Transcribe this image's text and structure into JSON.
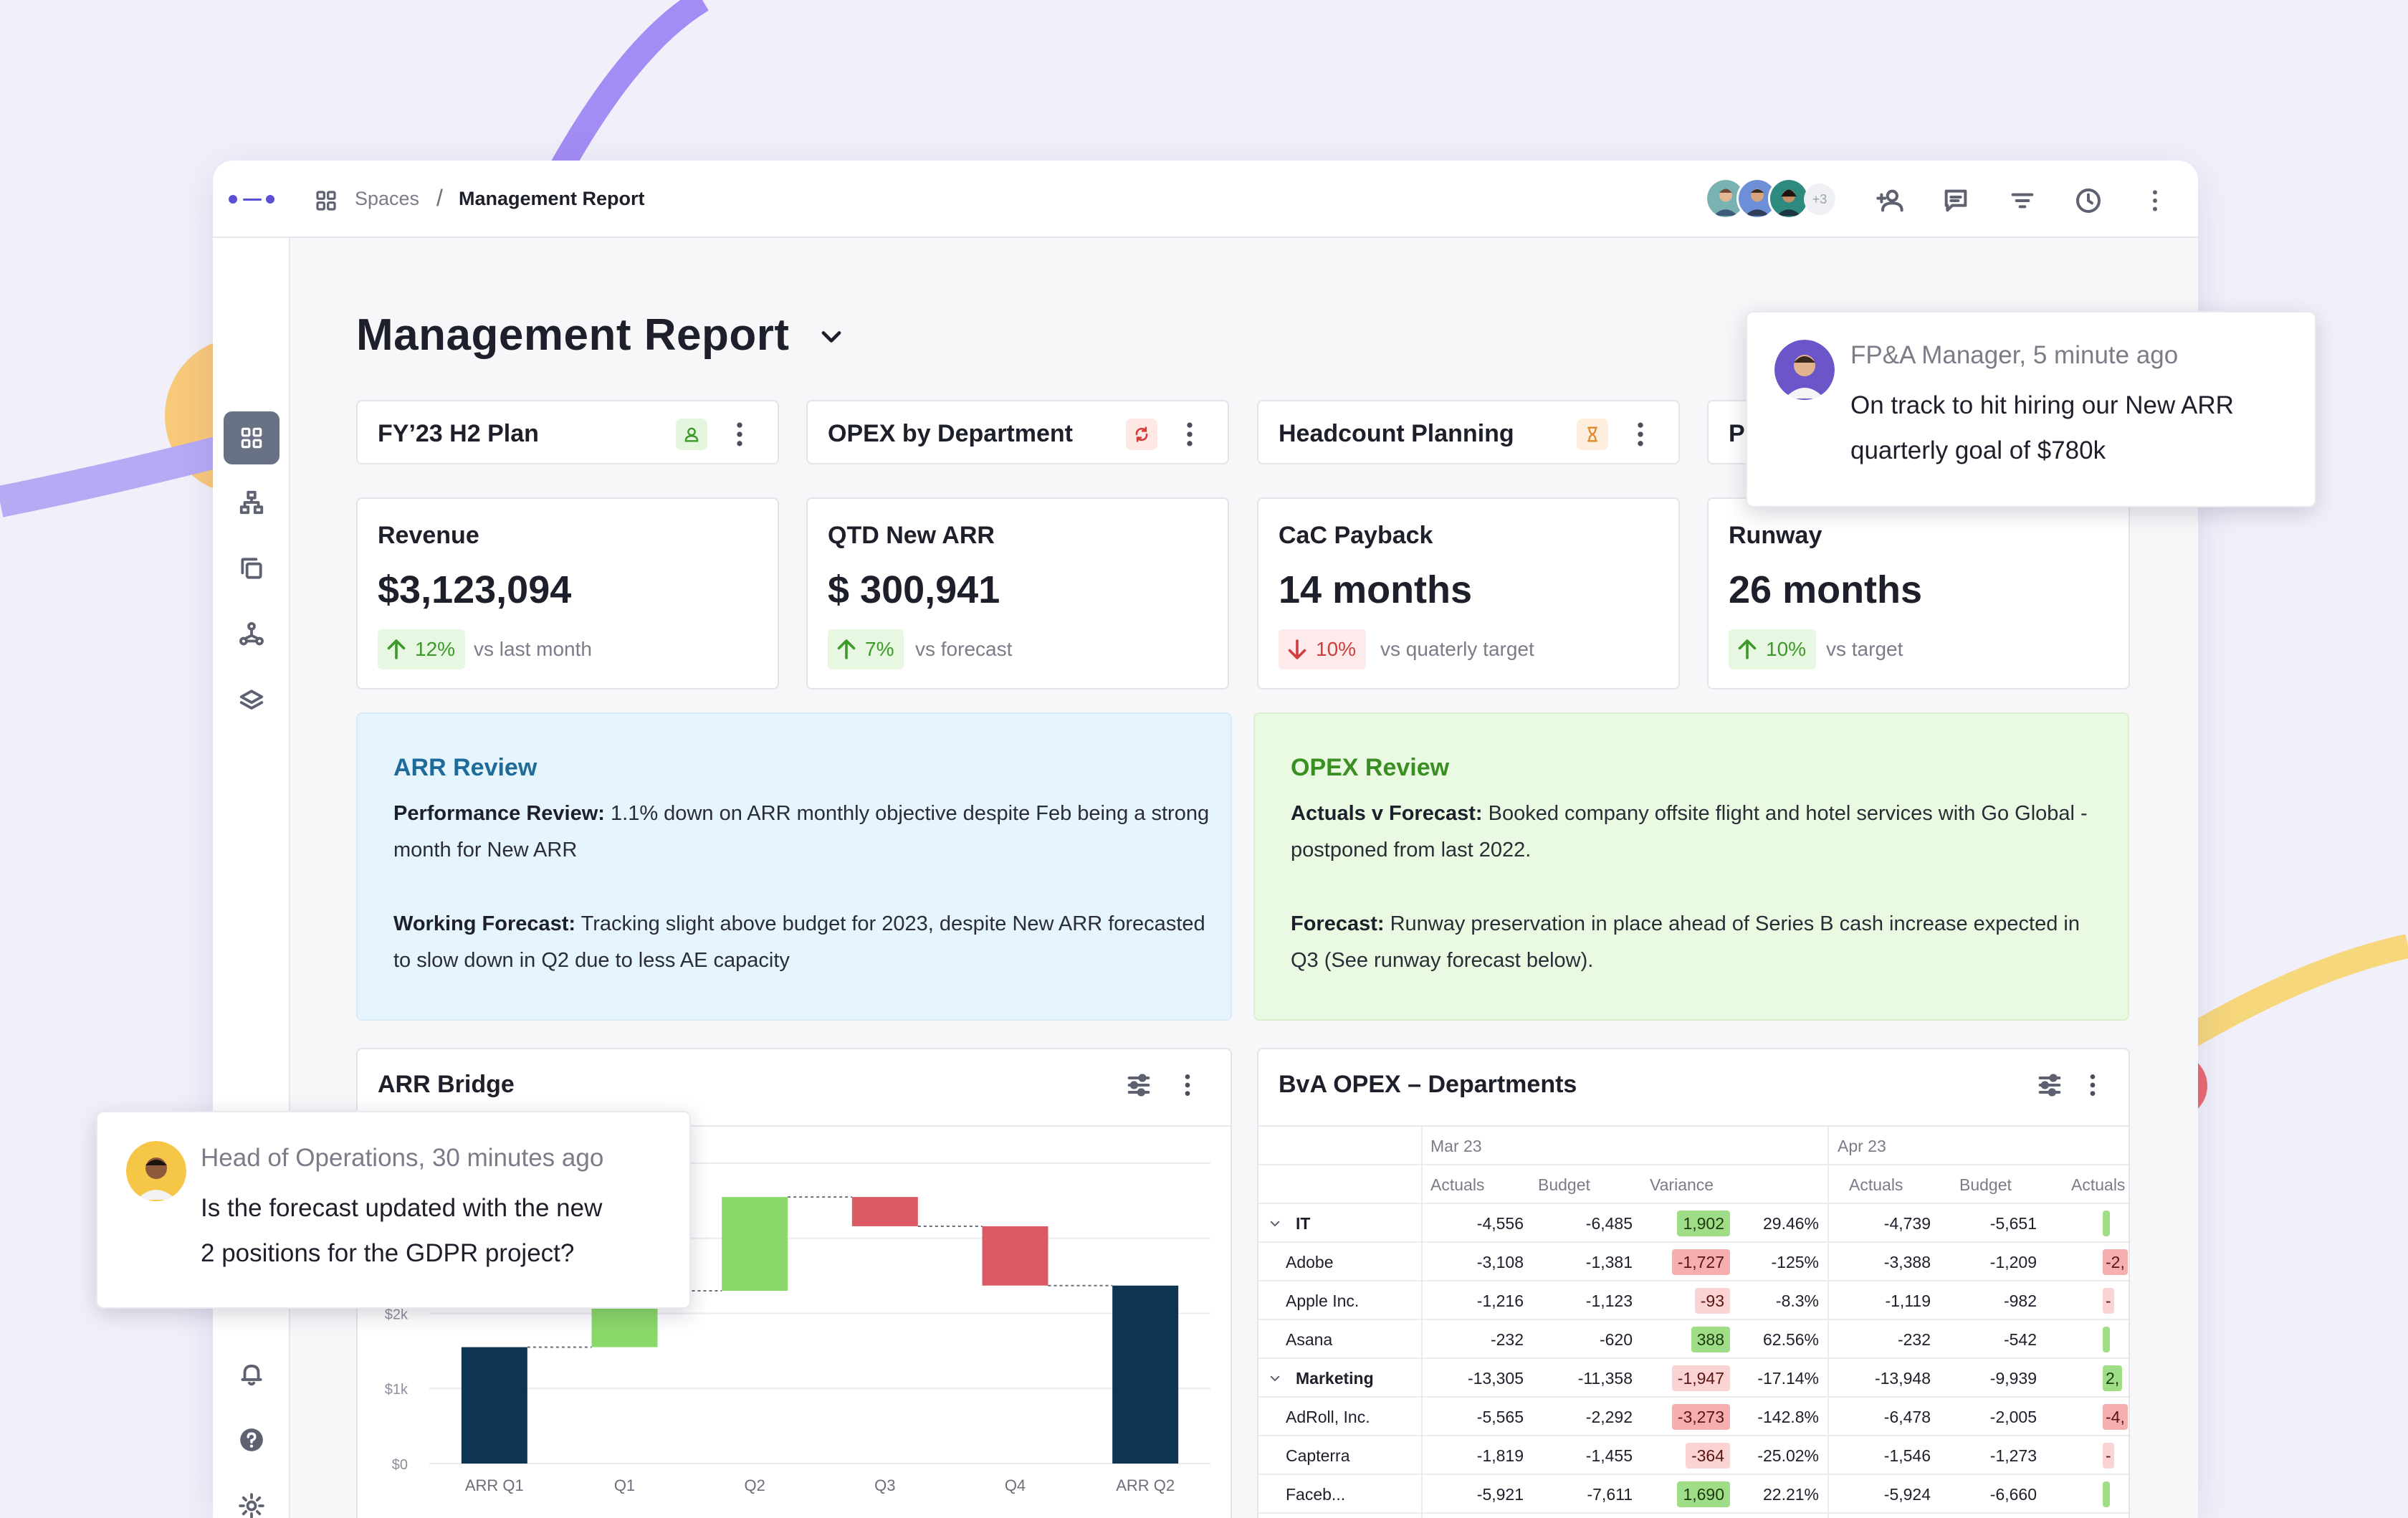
{
  "breadcrumb": {
    "root": "Spaces",
    "separator": "/",
    "current": "Management Report"
  },
  "header": {
    "more_collaborators": "+3"
  },
  "page": {
    "title": "Management Report"
  },
  "tabs": [
    {
      "label": "FY’23 H2 Plan",
      "badge_icon": "user-icon",
      "badge_color": "#e5f6df"
    },
    {
      "label": "OPEX by Department",
      "badge_icon": "refresh-icon",
      "badge_color": "#fde8e6"
    },
    {
      "label": "Headcount Planning",
      "badge_icon": "hourglass-icon",
      "badge_color": "#fdeede"
    },
    {
      "label": "P"
    }
  ],
  "kpis": [
    {
      "title": "Revenue",
      "value": "$3,123,094",
      "delta": "12%",
      "direction": "up",
      "note": "vs last month"
    },
    {
      "title": "QTD New ARR",
      "value": "$ 300,941",
      "delta": "7%",
      "direction": "up",
      "note": "vs forecast"
    },
    {
      "title": "CaC Payback",
      "value": "14 months",
      "delta": "10%",
      "direction": "down",
      "note": "vs quaterly target"
    },
    {
      "title": "Runway",
      "value": "26 months",
      "delta": "10%",
      "direction": "up",
      "note": "vs target"
    }
  ],
  "arr_review": {
    "title": "ARR Review",
    "p1_label": "Performance Review:",
    "p1_text": " 1.1% down on ARR monthly objective despite Feb being a strong month for New ARR",
    "p2_label": "Working Forecast:",
    "p2_text": " Tracking slight above budget for 2023, despite New ARR forecasted to slow down in Q2 due to less AE capacity"
  },
  "opex_review": {
    "title": "OPEX Review",
    "p1_label": "Actuals v Forecast:",
    "p1_text": " Booked company offsite flight and hotel services with Go Global - postponed from last 2022.",
    "p2_label": "Forecast:",
    "p2_text": " Runway preservation in place ahead of Series B cash increase expected in Q3 (See runway forecast below)."
  },
  "arr_bridge": {
    "title": "ARR Bridge"
  },
  "chart_data": {
    "type": "bar",
    "subtype": "waterfall",
    "title": "ARR Bridge",
    "categories": [
      "ARR Q1",
      "Q1",
      "Q2",
      "Q3",
      "Q4",
      "ARR Q2"
    ],
    "bars": [
      {
        "category": "ARR Q1",
        "start": 0,
        "end": 1550,
        "kind": "total"
      },
      {
        "category": "Q1",
        "start": 1550,
        "end": 2300,
        "kind": "increase"
      },
      {
        "category": "Q2",
        "start": 2300,
        "end": 3550,
        "kind": "increase"
      },
      {
        "category": "Q3",
        "start": 3550,
        "end": 3160,
        "kind": "decrease"
      },
      {
        "category": "Q4",
        "start": 3160,
        "end": 2370,
        "kind": "decrease"
      },
      {
        "category": "ARR Q2",
        "start": 0,
        "end": 2370,
        "kind": "total"
      }
    ],
    "yticks": [
      "$0",
      "$1k",
      "$2k"
    ],
    "ylim": [
      0,
      4200
    ],
    "colors": {
      "total": "#0d3552",
      "increase": "#8ad86a",
      "decrease": "#dc5a64"
    }
  },
  "bva": {
    "title": "BvA OPEX – Departments",
    "periods": [
      "Mar 23",
      "Apr 23"
    ],
    "columns": [
      "Actuals",
      "Budget",
      "Variance",
      "Actuals",
      "Budget",
      "Actuals"
    ],
    "rows": [
      {
        "name": "IT",
        "group": true,
        "m_act": "-4,556",
        "m_bud": "-6,485",
        "var": "1,902",
        "var_kind": "pos",
        "pct": "29.46%",
        "a_act": "-4,739",
        "a_bud": "-5,651",
        "a_act2": "",
        "a2_kind": "pos"
      },
      {
        "name": "Adobe",
        "group": false,
        "m_act": "-3,108",
        "m_bud": "-1,381",
        "var": "-1,727",
        "var_kind": "neg",
        "pct": "-125%",
        "a_act": "-3,388",
        "a_bud": "-1,209",
        "a_act2": "-2,",
        "a2_kind": "neg"
      },
      {
        "name": "Apple Inc.",
        "group": false,
        "m_act": "-1,216",
        "m_bud": "-1,123",
        "var": "-93",
        "var_kind": "negl",
        "pct": "-8.3%",
        "a_act": "-1,119",
        "a_bud": "-982",
        "a_act2": "-",
        "a2_kind": "negl"
      },
      {
        "name": "Asana",
        "group": false,
        "m_act": "-232",
        "m_bud": "-620",
        "var": "388",
        "var_kind": "pos",
        "pct": "62.56%",
        "a_act": "-232",
        "a_bud": "-542",
        "a_act2": "",
        "a2_kind": "pos"
      },
      {
        "name": "Marketing",
        "group": true,
        "m_act": "-13,305",
        "m_bud": "-11,358",
        "var": "-1,947",
        "var_kind": "negl",
        "pct": "-17.14%",
        "a_act": "-13,948",
        "a_bud": "-9,939",
        "a_act2": "2,",
        "a2_kind": "pos"
      },
      {
        "name": "AdRoll, Inc.",
        "group": false,
        "m_act": "-5,565",
        "m_bud": "-2,292",
        "var": "-3,273",
        "var_kind": "neg",
        "pct": "-142.8%",
        "a_act": "-6,478",
        "a_bud": "-2,005",
        "a_act2": "-4,",
        "a2_kind": "neg"
      },
      {
        "name": "Capterra",
        "group": false,
        "m_act": "-1,819",
        "m_bud": "-1,455",
        "var": "-364",
        "var_kind": "negl",
        "pct": "-25.02%",
        "a_act": "-1,546",
        "a_bud": "-1,273",
        "a_act2": "-",
        "a2_kind": "negl"
      },
      {
        "name": "Faceb...",
        "group": false,
        "m_act": "-5,921",
        "m_bud": "-7,611",
        "var": "1,690",
        "var_kind": "pos",
        "pct": "22.21%",
        "a_act": "-5,924",
        "a_bud": "-6,660",
        "a_act2": "",
        "a2_kind": "pos"
      }
    ]
  },
  "comments": [
    {
      "author_time": "FP&A Manager, 5 minute ago",
      "line1": "On track to hit hiring our New ARR",
      "line2": "quarterly goal of $780k"
    },
    {
      "author_time": "Head of Operations, 30 minutes ago",
      "line1": "Is the forecast updated with the new",
      "line2": "2 positions for the GDPR project?"
    }
  ],
  "colors": {
    "accent": "#5b4fd6",
    "arr_box": "#e6f4fd",
    "opex_box": "#eafae2"
  }
}
